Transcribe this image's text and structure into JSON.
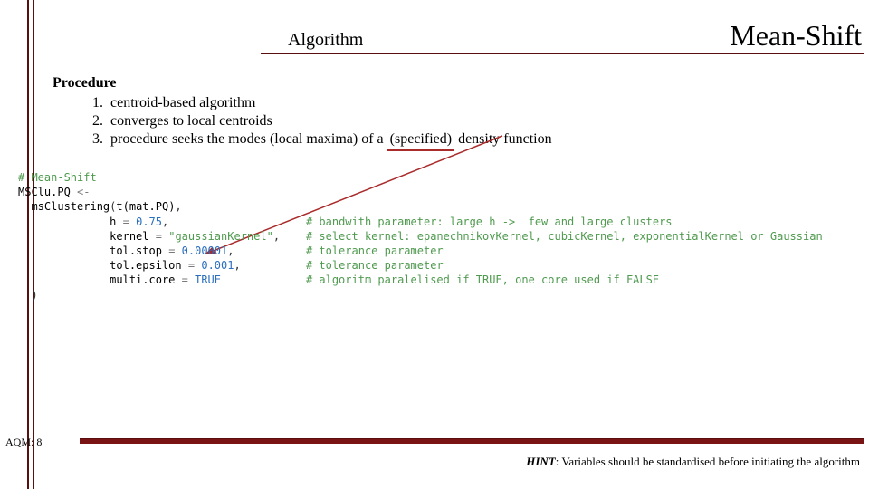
{
  "header": {
    "algorithm_label": "Algorithm",
    "title": "Mean-Shift"
  },
  "procedure": {
    "heading": "Procedure",
    "items": [
      "centroid-based algorithm",
      "converges to local centroids",
      "procedure seeks the modes (local maxima) of a (specified) density function"
    ],
    "highlight_word": "(specified)"
  },
  "code": {
    "comment_top": "# Mean-Shift",
    "assign_lhs": "MSClu.PQ",
    "assign_op": "<-",
    "fn": "msClustering",
    "arg_data": "t(mat.PQ)",
    "args": [
      {
        "name": "h",
        "value": "0.75",
        "type": "num",
        "comment": "# bandwith parameter: large h ->  few and large clusters"
      },
      {
        "name": "kernel",
        "value": "\"gaussianKernel\"",
        "type": "str",
        "comment": "# select kernel: epanechnikovKernel, cubicKernel, exponentialKernel or Gaussian"
      },
      {
        "name": "tol.stop",
        "value": "0.00001",
        "type": "num",
        "comment": "# tolerance parameter"
      },
      {
        "name": "tol.epsilon",
        "value": "0.001",
        "type": "num",
        "comment": "# tolerance parameter"
      },
      {
        "name": "multi.core",
        "value": "TRUE",
        "type": "kw",
        "comment": "# algoritm paralelised if TRUE, one core used if FALSE"
      }
    ]
  },
  "footer": {
    "slug": "AQM: 8",
    "hint_label": "HINT",
    "hint_text": ": Variables should be standardised before initiating the algorithm"
  }
}
